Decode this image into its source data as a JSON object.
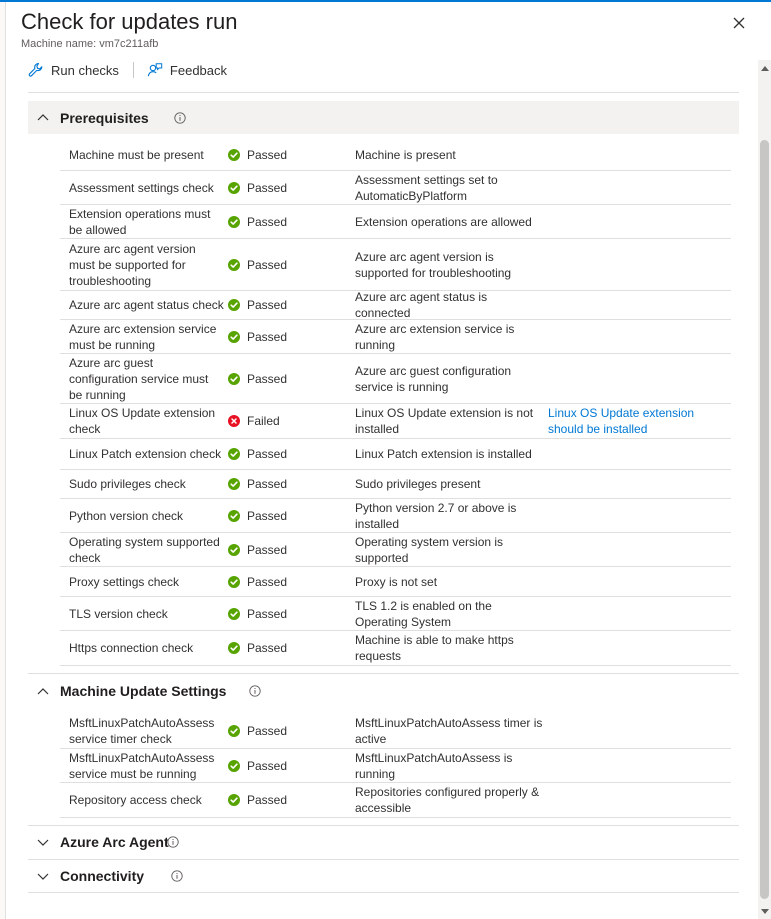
{
  "panel": {
    "title": "Check for updates run",
    "machine_name": "Machine name: vm7c211afb"
  },
  "toolbar": {
    "run_checks": "Run checks",
    "feedback": "Feedback"
  },
  "colors": {
    "accent": "#0078d4",
    "passed": "#57a300",
    "failed": "#e81123",
    "link": "#0078d4"
  },
  "sections": [
    {
      "title": "Prerequisites",
      "expanded": true,
      "rows": [
        {
          "check": "Machine must be present",
          "status": "Passed",
          "result": "Machine is present",
          "remediation": ""
        },
        {
          "check": "Assessment settings check",
          "status": "Passed",
          "result": "Assessment settings set to AutomaticByPlatform",
          "remediation": ""
        },
        {
          "check": "Extension operations must be allowed",
          "status": "Passed",
          "result": "Extension operations are allowed",
          "remediation": ""
        },
        {
          "check": "Azure arc agent version must be supported for troubleshooting",
          "status": "Passed",
          "result": "Azure arc agent version is supported for troubleshooting",
          "remediation": ""
        },
        {
          "check": "Azure arc agent status check",
          "status": "Passed",
          "result": "Azure arc agent status is connected",
          "remediation": ""
        },
        {
          "check": "Azure arc extension service must be running",
          "status": "Passed",
          "result": "Azure arc extension service is running",
          "remediation": ""
        },
        {
          "check": "Azure arc guest configuration service must be running",
          "status": "Passed",
          "result": "Azure arc guest configuration service is running",
          "remediation": ""
        },
        {
          "check": "Linux OS Update extension check",
          "status": "Failed",
          "result": "Linux OS Update extension is not installed",
          "remediation": "Linux OS Update extension should be installed"
        },
        {
          "check": "Linux Patch extension check",
          "status": "Passed",
          "result": "Linux Patch extension is installed",
          "remediation": ""
        },
        {
          "check": "Sudo privileges check",
          "status": "Passed",
          "result": "Sudo privileges present",
          "remediation": ""
        },
        {
          "check": "Python version check",
          "status": "Passed",
          "result": "Python version 2.7 or above is installed",
          "remediation": ""
        },
        {
          "check": "Operating system supported check",
          "status": "Passed",
          "result": "Operating system version is supported",
          "remediation": ""
        },
        {
          "check": "Proxy settings check",
          "status": "Passed",
          "result": "Proxy is not set",
          "remediation": ""
        },
        {
          "check": "TLS version check",
          "status": "Passed",
          "result": "TLS 1.2 is enabled on the Operating System",
          "remediation": ""
        },
        {
          "check": "Https connection check",
          "status": "Passed",
          "result": "Machine is able to make https requests",
          "remediation": ""
        }
      ]
    },
    {
      "title": "Machine Update Settings",
      "expanded": true,
      "rows": [
        {
          "check": "MsftLinuxPatchAutoAssess service timer check",
          "status": "Passed",
          "result": "MsftLinuxPatchAutoAssess timer is active",
          "remediation": ""
        },
        {
          "check": "MsftLinuxPatchAutoAssess service must be running",
          "status": "Passed",
          "result": "MsftLinuxPatchAutoAssess is running",
          "remediation": ""
        },
        {
          "check": "Repository access check",
          "status": "Passed",
          "result": "Repositories configured properly & accessible",
          "remediation": ""
        }
      ]
    },
    {
      "title": "Azure Arc Agent",
      "expanded": false,
      "rows": []
    },
    {
      "title": "Connectivity",
      "expanded": false,
      "rows": []
    }
  ],
  "icons": {
    "passed": "check-circle-icon",
    "failed": "error-circle-icon",
    "info": "info-icon",
    "close": "close-icon",
    "run_checks": "wrench-icon",
    "feedback": "feedback-icon",
    "expanded": "chevron-up-icon",
    "collapsed": "chevron-down-icon"
  }
}
